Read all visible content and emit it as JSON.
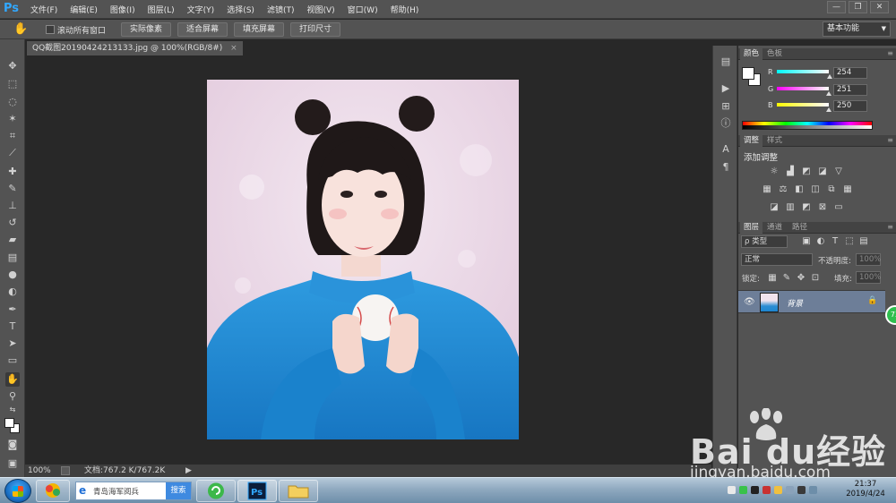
{
  "app": {
    "logo": "Ps",
    "menus": [
      "文件(F)",
      "编辑(E)",
      "图像(I)",
      "图层(L)",
      "文字(Y)",
      "选择(S)",
      "滤镜(T)",
      "视图(V)",
      "窗口(W)",
      "帮助(H)"
    ],
    "window_buttons": [
      "—",
      "❐",
      "✕"
    ]
  },
  "options": {
    "scroll_all_label": "滚动所有窗口",
    "buttons": [
      "实际像素",
      "适合屏幕",
      "填充屏幕",
      "打印尺寸"
    ],
    "workspace": "基本功能"
  },
  "document": {
    "tab_title": "QQ截图20190424213133.jpg @ 100%(RGB/8#)",
    "tab_close": "×",
    "zoom": "100%",
    "doc_size": "文档:767.2 K/767.2K"
  },
  "color_panel": {
    "tabs": [
      "颜色",
      "色板"
    ],
    "channels": [
      {
        "name": "R",
        "value": "254"
      },
      {
        "name": "G",
        "value": "251"
      },
      {
        "name": "B",
        "value": "250"
      }
    ]
  },
  "adjust_panel": {
    "tabs": [
      "调整",
      "样式"
    ],
    "title": "添加调整"
  },
  "layers_panel": {
    "tabs": [
      "图层",
      "通道",
      "路径"
    ],
    "kind_filter": "ρ 类型",
    "blend_mode": "正常",
    "opacity_label": "不透明度:",
    "opacity_value": "100%",
    "lock_label": "锁定:",
    "fill_label": "填充:",
    "fill_value": "100%",
    "layer_name": "背景",
    "side_badge": "73"
  },
  "taskbar": {
    "search_text": "青岛海军阅兵",
    "search_button": "搜索",
    "time": "21:37",
    "date": "2019/4/24"
  },
  "watermark": {
    "brand": "Bai du经验",
    "url": "jingyan.baidu.com"
  },
  "colors": {
    "accent": "#31a8ff",
    "panel": "#535353",
    "selected_layer": "#6d7e98"
  }
}
